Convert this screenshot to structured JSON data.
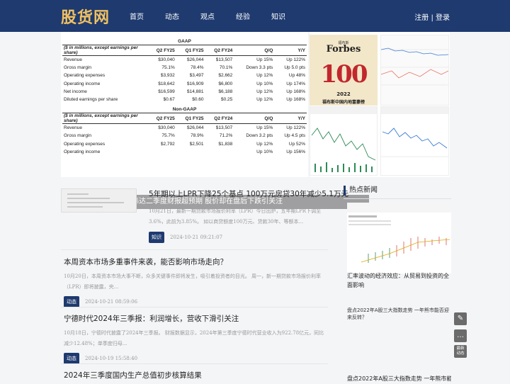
{
  "site": {
    "logo": "股货网",
    "nav": [
      "首页",
      "动态",
      "观点",
      "经验",
      "知识"
    ],
    "register": "注册",
    "divider": "|",
    "login": "登录"
  },
  "feature": {
    "gaap_title": "GAAP",
    "nongaap_title": "Non-GAAP",
    "note": "($ in millions, except earnings per share)",
    "columns": [
      "Q2 FY25",
      "Q1 FY25",
      "Q2 FY24",
      "Q/Q",
      "Y/Y"
    ],
    "gaap_rows": [
      [
        "Revenue",
        "$30,040",
        "$26,044",
        "$13,507",
        "Up 15%",
        "Up 122%"
      ],
      [
        "Gross margin",
        "75.1%",
        "78.4%",
        "70.1%",
        "Down 3.3 pts",
        "Up 5.0 pts"
      ],
      [
        "Operating expenses",
        "$3,932",
        "$3,497",
        "$2,662",
        "Up 12%",
        "Up 48%"
      ],
      [
        "Operating income",
        "$18,642",
        "$16,909",
        "$6,800",
        "Up 10%",
        "Up 174%"
      ],
      [
        "Net income",
        "$16,599",
        "$14,881",
        "$6,188",
        "Up 12%",
        "Up 168%"
      ],
      [
        "Diluted earnings per share",
        "$0.67",
        "$0.60",
        "$0.25",
        "Up 12%",
        "Up 168%"
      ]
    ],
    "nongaap_rows": [
      [
        "Revenue",
        "$30,040",
        "$26,044",
        "$13,507",
        "Up 15%",
        "Up 122%"
      ],
      [
        "Gross margin",
        "75.7%",
        "78.9%",
        "71.2%",
        "Down 3.2 pts",
        "Up 4.5 pts"
      ],
      [
        "Operating expenses",
        "$2,792",
        "$2,501",
        "$1,838",
        "Up 12%",
        "Up 52%"
      ],
      [
        "Operating income",
        "",
        "",
        "",
        "Up 10%",
        "Up 156%"
      ]
    ],
    "caption": "英伟达二季度财报超预期 股价却在盘后下跌引关注",
    "forbes": {
      "brand": "Forbes",
      "brand_cn": "福布斯",
      "number": "100",
      "year": "2022",
      "subtitle": "福布斯中国内地富豪榜"
    }
  },
  "articles": [
    {
      "title": "5年期以上LPR下降25个基点 100万元房贷30年减少5.1万元",
      "desc": "10月21日，最新一期贷款市场报价利率（LPR）今日出炉，五年期LPR下调至3.6%，此前为3.85%。 如以商贷额度100万元、贷款30年、等额本...",
      "tag": "知识",
      "date": "2024-10-21 09:21:07"
    },
    {
      "title": "本周资本市场多重事件来袭，能否影响市场走向？",
      "desc": "10月20日，本周资本市场大事不断，众多关键事件即将发生，吸引着投资者的目光。 周一，新一期贷款市场报价利率（LPR）即将披露，央...",
      "tag": "动态",
      "date": "2024-10-21 08:59:06"
    },
    {
      "title": "宁德时代2024年三季报：利润增长，营收下滑引关注",
      "desc": "10月18日，宁德时代披露了2024年三季报。 财报数据显示，2024年第三季度宁德时代营业收入为922.78亿元，同比减少12.48%；单季度归母...",
      "tag": "动态",
      "date": "2024-10-19 15:58:40"
    },
    {
      "title": "2024年三季度国内生产总值初步核算结果",
      "desc": "",
      "tag": "",
      "date": ""
    }
  ],
  "hot": {
    "header": "热点新闻",
    "items": [
      {
        "title": "汇率波动的经济效应：从贸易到投资的全面影响"
      },
      {
        "alt": "盘点2022年A股三大指数走势 一年熊市能否迎来反转？"
      },
      {
        "title": "盘点2022年A股三大指数走势 一年熊市能"
      }
    ]
  },
  "tools": [
    "✎",
    "…",
    "最新\n动态"
  ]
}
